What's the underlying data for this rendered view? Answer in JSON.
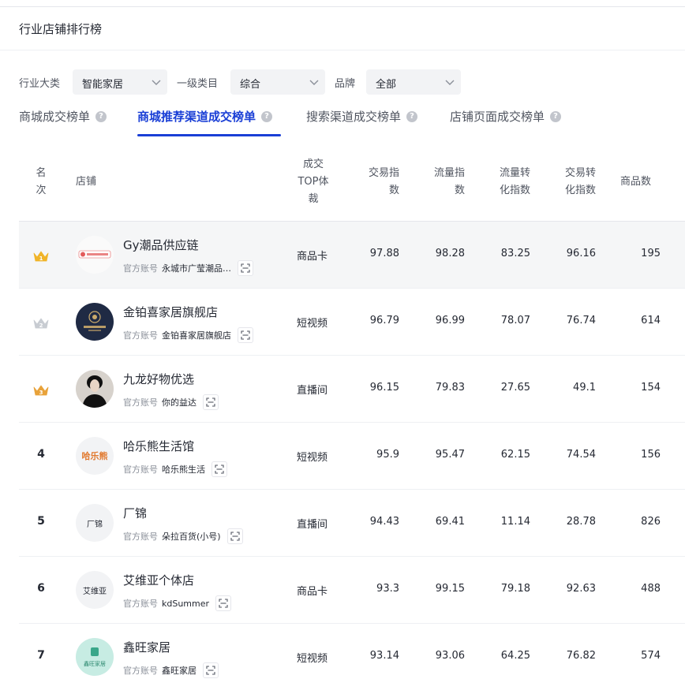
{
  "page": {
    "title": "行业店铺排行榜"
  },
  "filters": {
    "industry": {
      "label": "行业大类",
      "value": "智能家居"
    },
    "category": {
      "label": "一级类目",
      "value": "综合"
    },
    "brand": {
      "label": "品牌",
      "value": "全部"
    }
  },
  "tabs": [
    {
      "label": "商城成交榜单",
      "active": false
    },
    {
      "label": "商城推荐渠道成交榜单",
      "active": true
    },
    {
      "label": "搜索渠道成交榜单",
      "active": false
    },
    {
      "label": "店铺页面成交榜单",
      "active": false
    }
  ],
  "table": {
    "headers": {
      "rank": [
        "名",
        "次"
      ],
      "shop": "店铺",
      "carrier": [
        "成交",
        "TOP体",
        "裁"
      ],
      "trade_index": [
        "交易指",
        "数"
      ],
      "traffic_index": [
        "流量指",
        "数"
      ],
      "traffic_conv": [
        "流量转",
        "化指数"
      ],
      "trade_conv": [
        "交易转",
        "化指数"
      ],
      "products": "商品数"
    },
    "account_tag": "官方账号",
    "rows": [
      {
        "rank": "1",
        "name": "Gy潮品供应链",
        "account": "永城市广莹潮品…",
        "logo": "Gy潮品供应链",
        "carrier": "商品卡",
        "trade": "97.88",
        "traffic": "98.28",
        "traffic_conv": "83.25",
        "trade_conv": "96.16",
        "products": "195"
      },
      {
        "rank": "2",
        "name": "金铂喜家居旗舰店",
        "account": "金铂喜家居旗舰店",
        "logo": "JINBOXI",
        "carrier": "短视频",
        "trade": "96.79",
        "traffic": "96.99",
        "traffic_conv": "78.07",
        "trade_conv": "76.74",
        "products": "614"
      },
      {
        "rank": "3",
        "name": "九龙好物优选",
        "account": "你的益达",
        "logo": "",
        "carrier": "直播间",
        "trade": "96.15",
        "traffic": "79.83",
        "traffic_conv": "27.65",
        "trade_conv": "49.1",
        "products": "154"
      },
      {
        "rank": "4",
        "name": "哈乐熊生活馆",
        "account": "哈乐熊生活",
        "logo": "哈乐熊",
        "carrier": "短视频",
        "trade": "95.9",
        "traffic": "95.47",
        "traffic_conv": "62.15",
        "trade_conv": "74.54",
        "products": "156"
      },
      {
        "rank": "5",
        "name": "厂锦",
        "account": "朵拉百货(小号)",
        "logo": "厂锦",
        "carrier": "直播间",
        "trade": "94.43",
        "traffic": "69.41",
        "traffic_conv": "11.14",
        "trade_conv": "28.78",
        "products": "826"
      },
      {
        "rank": "6",
        "name": "艾维亚个体店",
        "account": "kdSummer",
        "logo": "艾维亚",
        "carrier": "商品卡",
        "trade": "93.3",
        "traffic": "99.15",
        "traffic_conv": "79.18",
        "trade_conv": "92.63",
        "products": "488"
      },
      {
        "rank": "7",
        "name": "鑫旺家居",
        "account": "鑫旺家居",
        "logo": "鑫旺家居",
        "carrier": "短视频",
        "trade": "93.14",
        "traffic": "93.06",
        "traffic_conv": "64.25",
        "trade_conv": "76.82",
        "products": "574"
      }
    ]
  },
  "colors": {
    "accent": "#1a3fd6",
    "gold": "#f0b429",
    "silver": "#c8ccd2",
    "bronze": "#e8a23a"
  }
}
